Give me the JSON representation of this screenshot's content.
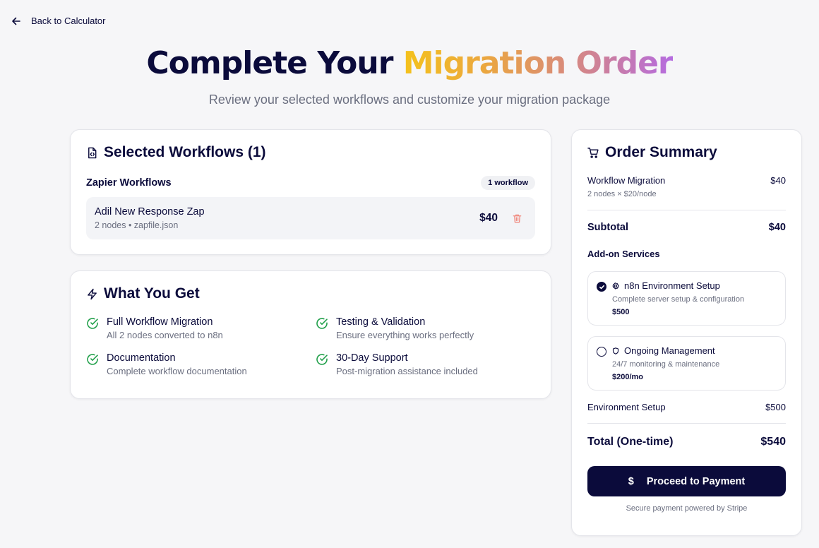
{
  "nav": {
    "back_label": "Back to Calculator"
  },
  "hero": {
    "title_plain": "Complete Your ",
    "title_gradient": "Migration Order",
    "subtitle": "Review your selected workflows and customize your migration package"
  },
  "selected": {
    "title": "Selected Workflows (1)",
    "group_name": "Zapier Workflows",
    "group_badge": "1 workflow",
    "items": [
      {
        "name": "Adil New Response Zap",
        "meta": "2 nodes • zapfile.json",
        "price": "$40"
      }
    ]
  },
  "get": {
    "title": "What You Get",
    "features": [
      {
        "title": "Full Workflow Migration",
        "desc": "All 2 nodes converted to n8n"
      },
      {
        "title": "Testing & Validation",
        "desc": "Ensure everything works perfectly"
      },
      {
        "title": "Documentation",
        "desc": "Complete workflow documentation"
      },
      {
        "title": "30-Day Support",
        "desc": "Post-migration assistance included"
      }
    ]
  },
  "summary": {
    "title": "Order Summary",
    "migration_label": "Workflow Migration",
    "migration_price": "$40",
    "migration_detail": "2 nodes × $20/node",
    "subtotal_label": "Subtotal",
    "subtotal_value": "$40",
    "addons_label": "Add-on Services",
    "addons": [
      {
        "name": "n8n Environment Setup",
        "desc": "Complete server setup & configuration",
        "price": "$500",
        "selected": true,
        "icon": "gear-icon"
      },
      {
        "name": "Ongoing Management",
        "desc": "24/7 monitoring & maintenance",
        "price": "$200/mo",
        "selected": false,
        "icon": "shield-icon"
      }
    ],
    "env_label": "Environment Setup",
    "env_value": "$500",
    "total_label": "Total (One-time)",
    "total_value": "$540",
    "pay_icon": "$",
    "pay_label": "Proceed to Payment",
    "secure_text": "Secure payment powered by Stripe"
  },
  "colors": {
    "navy": "#0b0b3b",
    "success_green": "#22a04b",
    "trash_red": "#f08a80",
    "gradient_start": "#f4c21c",
    "gradient_end": "#b56be0"
  }
}
